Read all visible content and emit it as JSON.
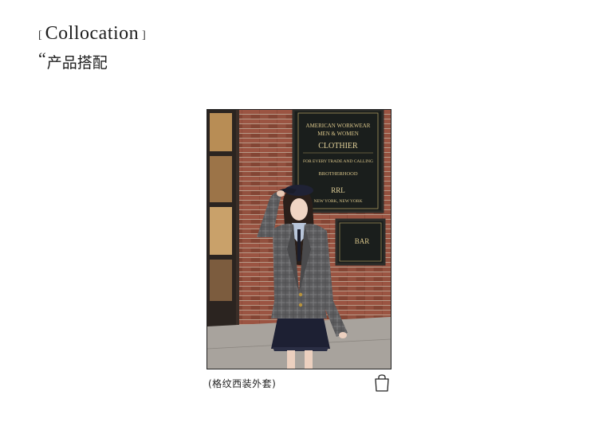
{
  "header": {
    "bracket_open": "[",
    "title_en": "Collocation",
    "bracket_close": "]",
    "quote_mark": "“",
    "subtitle_zh": "产品搭配"
  },
  "product": {
    "image_sign_lines": [
      "AMERICAN WORKWEAR",
      "MEN & WOMEN",
      "CLOTHIER",
      "FOR EVERY TRADE AND CALLING",
      "BROTHERHOOD",
      "RRL",
      "NEW YORK, NEW YORK"
    ],
    "image_sign_lower": "BAR",
    "caption": "(格纹西装外套)",
    "icon": "shopping-bag-icon"
  }
}
